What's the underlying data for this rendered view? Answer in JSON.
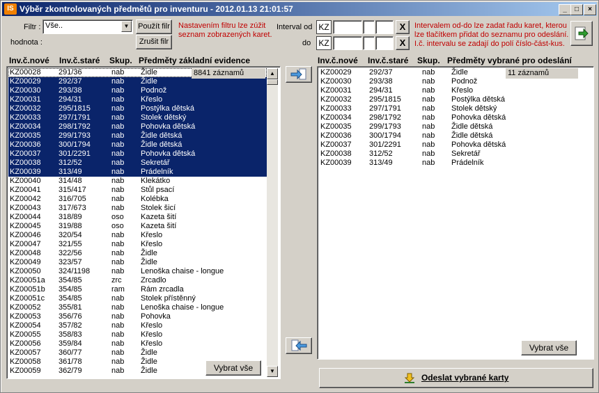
{
  "window": {
    "title": "Výběr zkontrolovaných předmětů pro inventuru - 2012.01.13 21:01:57",
    "app_icon": "IS"
  },
  "filter": {
    "filter_label": "Filtr :",
    "value_label": "hodnota :",
    "selected": "Vše..",
    "apply_label": "Použít filr",
    "cancel_label": "Zrušit filr",
    "note": [
      "Nastavením filtru lze zúžit",
      "seznam zobrazených karet."
    ]
  },
  "interval": {
    "from_label": "Interval od",
    "to_label": "do",
    "prefix": "KZ",
    "clear_glyph": "X",
    "note": [
      "Intervalem od-do lze zadat řadu karet, kterou",
      "lze tlačítkem přidat do seznamu pro odeslání.",
      "I.č. intervalu se zadají do polí číslo-část-kus."
    ]
  },
  "left_list": {
    "headers": [
      "Inv.č.nové",
      "Inv.č.staré",
      "Skup.",
      "Předměty základní evidence"
    ],
    "count": "8841 záznamů",
    "select_all": "Vybrat vše",
    "rows": [
      [
        "KZ00028",
        "291/36",
        "nab",
        "Židle"
      ],
      [
        "KZ00029",
        "292/37",
        "nab",
        "Židle"
      ],
      [
        "KZ00030",
        "293/38",
        "nab",
        "Podnož"
      ],
      [
        "KZ00031",
        "294/31",
        "nab",
        "Křeslo"
      ],
      [
        "KZ00032",
        "295/1815",
        "nab",
        "Postýlka dětská"
      ],
      [
        "KZ00033",
        "297/1791",
        "nab",
        "Stolek dětský"
      ],
      [
        "KZ00034",
        "298/1792",
        "nab",
        "Pohovka dětská"
      ],
      [
        "KZ00035",
        "299/1793",
        "nab",
        "Židle dětská"
      ],
      [
        "KZ00036",
        "300/1794",
        "nab",
        "Židle dětská"
      ],
      [
        "KZ00037",
        "301/2291",
        "nab",
        "Pohovka dětská"
      ],
      [
        "KZ00038",
        "312/52",
        "nab",
        "Sekretář"
      ],
      [
        "KZ00039",
        "313/49",
        "nab",
        "Prádelník"
      ],
      [
        "KZ00040",
        "314/48",
        "nab",
        "Klekátko"
      ],
      [
        "KZ00041",
        "315/417",
        "nab",
        "Stůl psací"
      ],
      [
        "KZ00042",
        "316/705",
        "nab",
        "Kolébka"
      ],
      [
        "KZ00043",
        "317/673",
        "nab",
        "Stolek šicí"
      ],
      [
        "KZ00044",
        "318/89",
        "oso",
        "Kazeta šití"
      ],
      [
        "KZ00045",
        "319/88",
        "oso",
        "Kazeta šití"
      ],
      [
        "KZ00046",
        "320/54",
        "nab",
        "Křeslo"
      ],
      [
        "KZ00047",
        "321/55",
        "nab",
        "Křeslo"
      ],
      [
        "KZ00048",
        "322/56",
        "nab",
        "Židle"
      ],
      [
        "KZ00049",
        "323/57",
        "nab",
        "Židle"
      ],
      [
        "KZ00050",
        "324/1198",
        "nab",
        "Lenoška chaise - longue"
      ],
      [
        "KZ00051a",
        "354/85",
        "zrc",
        "Zrcadlo"
      ],
      [
        "KZ00051b",
        "354/85",
        "ram",
        "Rám zrcadla"
      ],
      [
        "KZ00051c",
        "354/85",
        "nab",
        "Stolek přístěnný"
      ],
      [
        "KZ00052",
        "355/81",
        "nab",
        "Lenoška chaise - longue"
      ],
      [
        "KZ00053",
        "356/76",
        "nab",
        "Pohovka"
      ],
      [
        "KZ00054",
        "357/82",
        "nab",
        "Křeslo"
      ],
      [
        "KZ00055",
        "358/83",
        "nab",
        "Křeslo"
      ],
      [
        "KZ00056",
        "359/84",
        "nab",
        "Křeslo"
      ],
      [
        "KZ00057",
        "360/77",
        "nab",
        "Židle"
      ],
      [
        "KZ00058",
        "361/78",
        "nab",
        "Židle"
      ],
      [
        "KZ00059",
        "362/79",
        "nab",
        "Židle"
      ]
    ],
    "selected_rows": [
      1,
      2,
      3,
      4,
      5,
      6,
      7,
      8,
      9,
      10,
      11
    ],
    "focused_row": 0
  },
  "right_list": {
    "headers": [
      "Inv.č.nové",
      "Inv.č.staré",
      "Skup.",
      "Předměty vybrané pro odeslání"
    ],
    "count": "11 záznamů",
    "select_all": "Vybrat vše",
    "rows": [
      [
        "KZ00029",
        "292/37",
        "nab",
        "Židle"
      ],
      [
        "KZ00030",
        "293/38",
        "nab",
        "Podnož"
      ],
      [
        "KZ00031",
        "294/31",
        "nab",
        "Křeslo"
      ],
      [
        "KZ00032",
        "295/1815",
        "nab",
        "Postýlka dětská"
      ],
      [
        "KZ00033",
        "297/1791",
        "nab",
        "Stolek dětský"
      ],
      [
        "KZ00034",
        "298/1792",
        "nab",
        "Pohovka dětská"
      ],
      [
        "KZ00035",
        "299/1793",
        "nab",
        "Židle dětská"
      ],
      [
        "KZ00036",
        "300/1794",
        "nab",
        "Židle dětská"
      ],
      [
        "KZ00037",
        "301/2291",
        "nab",
        "Pohovka dětská"
      ],
      [
        "KZ00038",
        "312/52",
        "nab",
        "Sekretář"
      ],
      [
        "KZ00039",
        "313/49",
        "nab",
        "Prádelník"
      ]
    ]
  },
  "send_button": {
    "label": "Odeslat vybrané karty"
  },
  "colors": {
    "selection": "#0a246a",
    "note_text": "#c00000",
    "face": "#d4d0c8"
  }
}
